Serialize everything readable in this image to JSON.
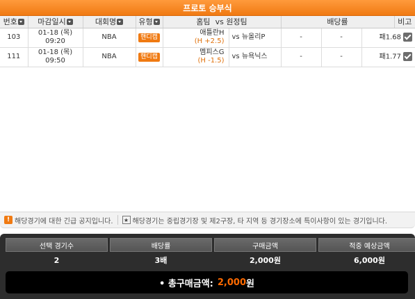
{
  "title": "프로토 승부식",
  "columns": {
    "no": "번호",
    "deadline": "마감일시",
    "league": "대회명",
    "type": "유형",
    "match_home": "홈팀",
    "match_vs": "vs",
    "match_away": "원정팀",
    "odds": "배당률",
    "note": "비고"
  },
  "rows": [
    {
      "no": "103",
      "date": "01-18 (목)",
      "time": "09:20",
      "league": "NBA",
      "type_badge": "핸디캡",
      "home": "애틀란H",
      "handicap": "(H +2.5)",
      "vs": "vs",
      "away": "뉴올리P",
      "odd1": "-",
      "odd2": "-",
      "pick": "패1.68",
      "checked": true
    },
    {
      "no": "111",
      "date": "01-18 (목)",
      "time": "09:50",
      "league": "NBA",
      "type_badge": "핸디캡",
      "home": "멤피스G",
      "handicap": "(H -1.5)",
      "vs": "vs",
      "away": "뉴욕닉스",
      "odd1": "-",
      "odd2": "-",
      "pick": "패1.77",
      "checked": true
    }
  ],
  "notices": {
    "urgent": "해당경기에 대한 긴급 공지입니다.",
    "special": "해당경기는 중립경기장 및 제2구장, 타 지역 등 경기장소에 특이사항이 있는 경기입니다.",
    "urgent_icon": "!",
    "special_icon": "★"
  },
  "summary": {
    "headers": [
      "선택 경기수",
      "배당률",
      "구매금액",
      "적중 예상금액"
    ],
    "values": [
      "2",
      "3배",
      "2,000원",
      "6,000원"
    ],
    "total_label": "• 총구매금액:",
    "total_amount": "2,000",
    "total_unit": "원"
  },
  "colors": {
    "accent": "#f07a12",
    "total_amount": "#ff6a00",
    "summary_bg": "#2d2d2d"
  }
}
